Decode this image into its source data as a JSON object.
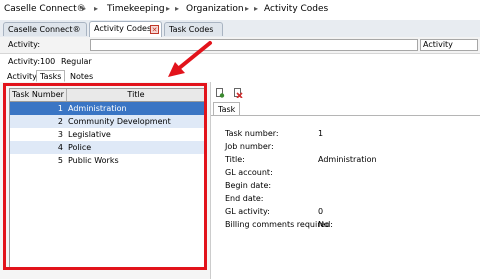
{
  "breadcrumb": {
    "items": [
      "Caselle Connect®",
      "Timekeeping",
      "Organization",
      "Activity Codes"
    ],
    "separator": "▸"
  },
  "tabs": [
    {
      "label": "Caselle Connect®"
    },
    {
      "label": "Activity Codes",
      "close_icon": "close-icon"
    },
    {
      "label": "Task Codes"
    }
  ],
  "activity_bar": {
    "label": "Activity:",
    "value": "",
    "dropdown_value": "Activity"
  },
  "summary": {
    "label": "Activity:",
    "code": "100",
    "name": "Regular"
  },
  "subtabs": [
    "Activity",
    "Tasks",
    "Notes"
  ],
  "task_table": {
    "columns": [
      "Task Number",
      "Title"
    ],
    "rows": [
      {
        "number": "1",
        "title": "Administration",
        "selected": true
      },
      {
        "number": "2",
        "title": "Community Development"
      },
      {
        "number": "3",
        "title": "Legislative"
      },
      {
        "number": "4",
        "title": "Police"
      },
      {
        "number": "5",
        "title": "Public Works"
      }
    ]
  },
  "right_panel": {
    "toolbar_icons": [
      "new-icon",
      "delete-icon"
    ],
    "tab": "Task",
    "fields": [
      {
        "label": "Task number:",
        "value": "1"
      },
      {
        "label": "Job number:",
        "value": ""
      },
      {
        "label": "Title:",
        "value": "Administration"
      },
      {
        "label": "GL account:",
        "value": ""
      },
      {
        "label": "Begin date:",
        "value": ""
      },
      {
        "label": "End date:",
        "value": ""
      },
      {
        "label": "GL activity:",
        "value": "0"
      },
      {
        "label": "Billing comments required:",
        "value": "No"
      }
    ]
  },
  "colors": {
    "highlight": "#e2131b",
    "selection": "#3a75c4",
    "alt_row": "#dfe9f7"
  }
}
